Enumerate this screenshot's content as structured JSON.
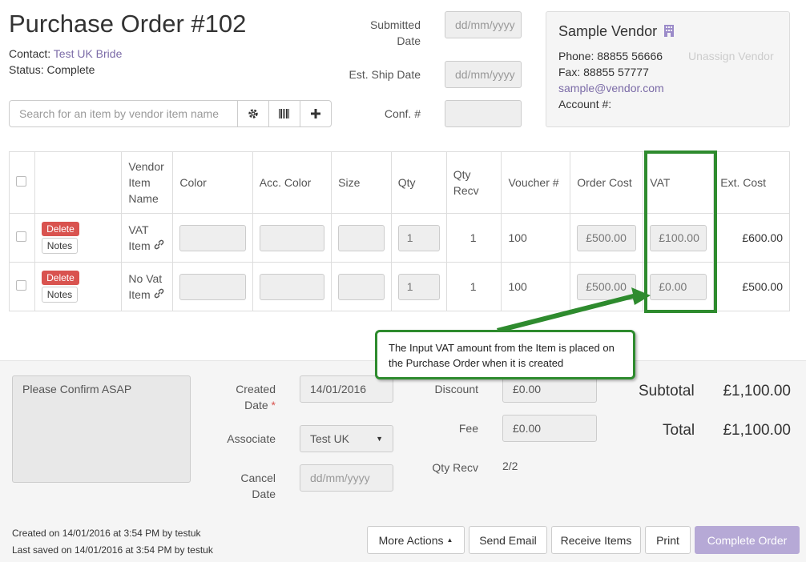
{
  "header": {
    "title": "Purchase Order #102",
    "contact_label": "Contact:",
    "contact_name": "Test UK Bride",
    "status_label": "Status:",
    "status_value": "Complete"
  },
  "dates": {
    "submitted_label": "Submitted Date",
    "submitted_placeholder": "dd/mm/yyyy",
    "ship_label": "Est. Ship Date",
    "ship_placeholder": "dd/mm/yyyy",
    "conf_label": "Conf. #",
    "conf_value": ""
  },
  "search": {
    "placeholder": "Search for an item by vendor item name"
  },
  "vendor": {
    "name": "Sample Vendor",
    "phone": "Phone: 88855 56666",
    "fax": "Fax: 88855 57777",
    "email": "sample@vendor.com",
    "account": "Account #:",
    "unassign": "Unassign Vendor"
  },
  "table": {
    "headers": {
      "vendor_item": "Vendor Item Name",
      "color": "Color",
      "acc_color": "Acc. Color",
      "size": "Size",
      "qty": "Qty",
      "qty_recv": "Qty Recv",
      "voucher": "Voucher #",
      "order_cost": "Order Cost",
      "vat": "VAT",
      "ext_cost": "Ext. Cost"
    },
    "delete_label": "Delete",
    "notes_label": "Notes",
    "rows": [
      {
        "name": "VAT Item",
        "qty": "1",
        "qty_recv": "1",
        "voucher": "100",
        "order_cost": "£500.00",
        "vat": "£100.00",
        "ext_cost": "£600.00"
      },
      {
        "name": "No Vat Item",
        "qty": "1",
        "qty_recv": "1",
        "voucher": "100",
        "order_cost": "£500.00",
        "vat": "£0.00",
        "ext_cost": "£500.00"
      }
    ]
  },
  "callout": {
    "text": "The Input VAT amount from the Item is placed on the Purchase Order when it is created"
  },
  "footer": {
    "notes_text": "Please Confirm ASAP",
    "created_label": "Created Date",
    "created_required": "*",
    "created_value": "14/01/2016",
    "associate_label": "Associate",
    "associate_value": "Test UK",
    "cancel_label": "Cancel Date",
    "cancel_placeholder": "dd/mm/yyyy",
    "discount_label": "Discount",
    "discount_value": "£0.00",
    "fee_label": "Fee",
    "fee_value": "£0.00",
    "qty_recv_label": "Qty Recv",
    "qty_recv_value": "2/2",
    "subtotal_label": "Subtotal",
    "subtotal_value": "£1,100.00",
    "total_label": "Total",
    "total_value": "£1,100.00",
    "created_info": "Created on 14/01/2016 at 3:54 PM by testuk",
    "saved_info": "Last saved on 14/01/2016 at 3:54 PM by testuk"
  },
  "actions": {
    "more": "More Actions",
    "send_email": "Send Email",
    "receive": "Receive Items",
    "print": "Print",
    "complete": "Complete Order"
  },
  "colors": {
    "link": "#7b6ba7",
    "delete": "#d9534f",
    "callout_border": "#2e8b2e",
    "complete_btn": "#b6a9d6"
  }
}
